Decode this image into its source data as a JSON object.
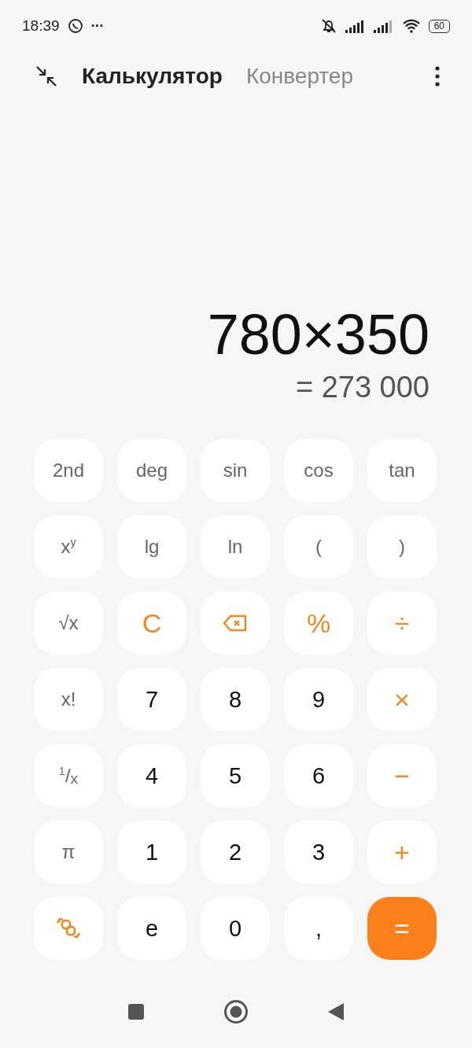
{
  "status_bar": {
    "time": "18:39",
    "overflow": "···",
    "battery": "60"
  },
  "header": {
    "tabs": [
      {
        "label": "Калькулятор",
        "selected": true
      },
      {
        "label": "Конвертер",
        "selected": false
      }
    ]
  },
  "display": {
    "expression": "780×350",
    "result": "= 273 000"
  },
  "keys": [
    {
      "kind": "fn",
      "label": "2nd"
    },
    {
      "kind": "fn",
      "label": "deg"
    },
    {
      "kind": "fn",
      "label": "sin"
    },
    {
      "kind": "fn",
      "label": "cos"
    },
    {
      "kind": "fn",
      "label": "tan"
    },
    {
      "kind": "fn",
      "label": "x$^{y}$"
    },
    {
      "kind": "fn",
      "label": "lg"
    },
    {
      "kind": "fn",
      "label": "ln"
    },
    {
      "kind": "fn",
      "label": "("
    },
    {
      "kind": "fn",
      "label": ")"
    },
    {
      "kind": "fn",
      "label": "√x"
    },
    {
      "kind": "op",
      "label": "C"
    },
    {
      "kind": "backspace"
    },
    {
      "kind": "op",
      "label": "%"
    },
    {
      "kind": "op",
      "label": "÷"
    },
    {
      "kind": "fn",
      "label": "x!"
    },
    {
      "kind": "digit",
      "label": "7"
    },
    {
      "kind": "digit",
      "label": "8"
    },
    {
      "kind": "digit",
      "label": "9"
    },
    {
      "kind": "op",
      "label": "×"
    },
    {
      "kind": "fn",
      "label": "$^{1}$/$_{x}$"
    },
    {
      "kind": "digit",
      "label": "4"
    },
    {
      "kind": "digit",
      "label": "5"
    },
    {
      "kind": "digit",
      "label": "6"
    },
    {
      "kind": "op",
      "label": "−"
    },
    {
      "kind": "fn",
      "label": "π"
    },
    {
      "kind": "digit",
      "label": "1"
    },
    {
      "kind": "digit",
      "label": "2"
    },
    {
      "kind": "digit",
      "label": "3"
    },
    {
      "kind": "op",
      "label": "+"
    },
    {
      "kind": "swap"
    },
    {
      "kind": "digit",
      "label": "e"
    },
    {
      "kind": "digit",
      "label": "0"
    },
    {
      "kind": "digit",
      "label": ","
    },
    {
      "kind": "equals",
      "label": "="
    }
  ]
}
